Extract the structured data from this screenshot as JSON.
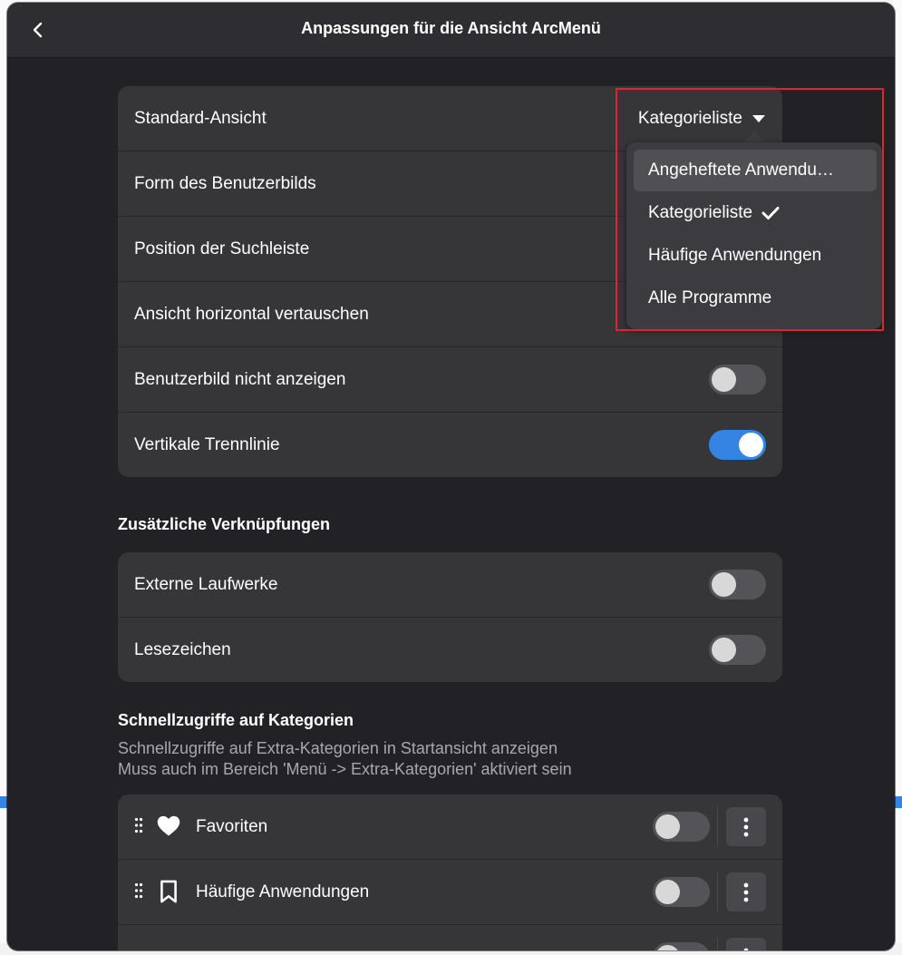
{
  "header": {
    "title": "Anpassungen für die Ansicht ArcMenü"
  },
  "general": {
    "rows": [
      {
        "label": "Standard-Ansicht",
        "value": "Kategorieliste"
      },
      {
        "label": "Form des Benutzerbilds"
      },
      {
        "label": "Position der Suchleiste"
      },
      {
        "label": "Ansicht horizontal vertauschen"
      },
      {
        "label": "Benutzerbild nicht anzeigen",
        "on": false
      },
      {
        "label": "Vertikale Trennlinie",
        "on": true
      }
    ]
  },
  "dropdown": {
    "options": [
      "Angeheftete Anwendu…",
      "Kategorieliste",
      "Häufige Anwendungen",
      "Alle Programme"
    ],
    "selected": "Kategorieliste"
  },
  "shortcuts": {
    "title": "Zusätzliche Verknüpfungen",
    "rows": [
      {
        "label": "Externe Laufwerke",
        "on": false
      },
      {
        "label": "Lesezeichen",
        "on": false
      }
    ]
  },
  "categories": {
    "title": "Schnellzugriffe auf Kategorien",
    "desc_line1": "Schnellzugriffe auf Extra-Kategorien in Startansicht anzeigen",
    "desc_line2": "Muss auch im Bereich 'Menü -> Extra-Kategorien' aktiviert sein",
    "rows": [
      {
        "label": "Favoriten",
        "icon": "heart-icon",
        "on": false
      },
      {
        "label": "Häufige Anwendungen",
        "icon": "bookmark-icon",
        "on": false
      }
    ]
  },
  "colors": {
    "accent": "#3584e4",
    "highlight": "#e0232f"
  }
}
